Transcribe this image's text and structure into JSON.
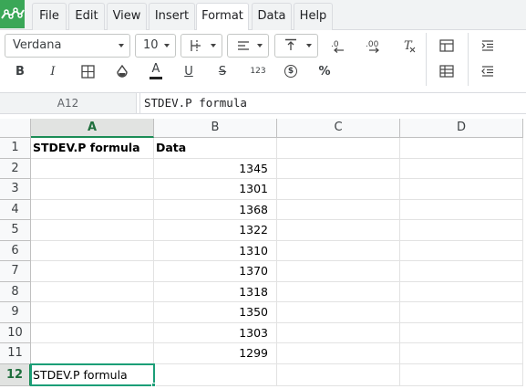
{
  "menu": {
    "file": "File",
    "edit": "Edit",
    "view": "View",
    "insert": "Insert",
    "format": "Format",
    "data": "Data",
    "help": "Help",
    "active": "Format"
  },
  "toolbar": {
    "font_name": "Verdana",
    "font_size": "10",
    "bold": "B",
    "italic": "I",
    "font_color_glyph": "A",
    "underline": "U",
    "strike": "S",
    "number_format": "123",
    "currency": "$",
    "percent": "%",
    "clear_format": "T",
    "accent_color": "#1b9e77"
  },
  "formula_bar": {
    "cell_ref": "A12",
    "content": "STDEV.P formula"
  },
  "sheet": {
    "columns": [
      "A",
      "B",
      "C",
      "D"
    ],
    "selected_column": "A",
    "selected_row": "12",
    "rows": [
      {
        "num": "1",
        "a": "STDEV.P formula",
        "b": "Data"
      },
      {
        "num": "2",
        "a": "",
        "b": "1345"
      },
      {
        "num": "3",
        "a": "",
        "b": "1301"
      },
      {
        "num": "4",
        "a": "",
        "b": "1368"
      },
      {
        "num": "5",
        "a": "",
        "b": "1322"
      },
      {
        "num": "6",
        "a": "",
        "b": "1310"
      },
      {
        "num": "7",
        "a": "",
        "b": "1370"
      },
      {
        "num": "8",
        "a": "",
        "b": "1318"
      },
      {
        "num": "9",
        "a": "",
        "b": "1350"
      },
      {
        "num": "10",
        "a": "",
        "b": "1303"
      },
      {
        "num": "11",
        "a": "",
        "b": "1299"
      },
      {
        "num": "12",
        "a": "STDEV.P formula",
        "b": ""
      }
    ]
  }
}
